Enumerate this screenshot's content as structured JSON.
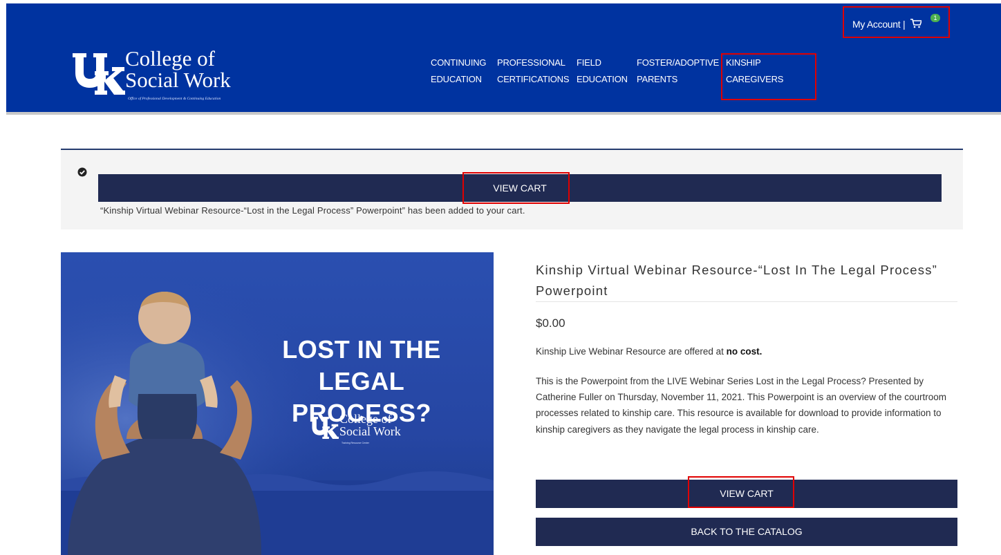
{
  "header": {
    "logo": {
      "name_line1": "College of",
      "name_line2": "Social Work",
      "tagline": "Office of Professional Development & Continuing Education"
    },
    "account": {
      "label": "My Account |",
      "cart_icon": "cart-icon",
      "cart_count": "1"
    },
    "nav": [
      {
        "line1": "CONTINUING",
        "line2": "EDUCATION"
      },
      {
        "line1": "PROFESSIONAL",
        "line2": "CERTIFICATIONS"
      },
      {
        "line1": "FIELD",
        "line2": "EDUCATION"
      },
      {
        "line1": "FOSTER/ADOPTIVE",
        "line2": "PARENTS"
      },
      {
        "line1": "KINSHIP",
        "line2": "CAREGIVERS"
      }
    ]
  },
  "notice": {
    "icon": "check-circle-icon",
    "button_label": "VIEW CART",
    "message": "“Kinship Virtual Webinar Resource-“Lost in the Legal Process” Powerpoint” has been added to your cart."
  },
  "hero": {
    "title_line1": "LOST IN THE",
    "title_line2": "LEGAL PROCESS?",
    "logo": {
      "line1": "College of",
      "line2": "Social Work",
      "tagline": "Training Resource Center"
    }
  },
  "product": {
    "title": "Kinship Virtual Webinar Resource-“Lost In The Legal Process” Powerpoint",
    "price": "$0.00",
    "cost_text": "Kinship Live Webinar Resource are offered at ",
    "cost_bold": "no cost.",
    "description": "This is the Powerpoint from the LIVE Webinar Series Lost in the Legal Process? Presented by Catherine Fuller on Thursday, November 11, 2021. This Powerpoint is an overview of the courtroom processes related to kinship care. This resource is available for download to provide information to kinship caregivers as they navigate the legal process in kinship care.",
    "view_cart_label": "VIEW CART",
    "back_label": "BACK TO THE CATALOG"
  },
  "colors": {
    "header_blue": "#0033a0",
    "button_navy": "#202a52",
    "highlight_red": "#e00000",
    "badge_green": "#4caf50"
  }
}
